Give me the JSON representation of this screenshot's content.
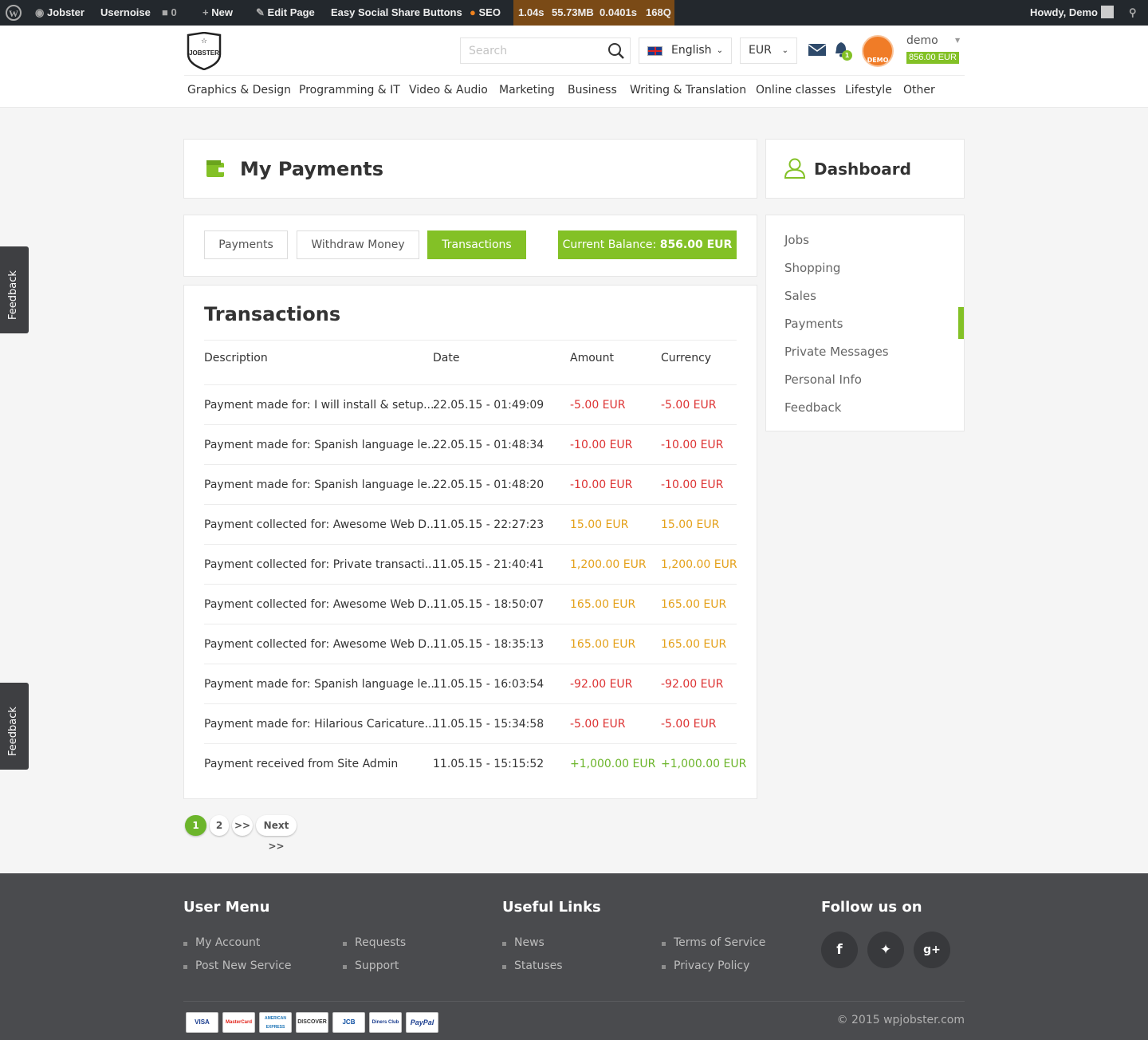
{
  "admin_bar": {
    "site": "Jobster",
    "plugin": "Usernoise",
    "comments": "0",
    "new": "New",
    "edit": "Edit Page",
    "social": "Easy Social Share Buttons",
    "seo": "SEO",
    "perf": {
      "time": "1.04s",
      "memory": "55.73MB",
      "db_time": "0.0401s",
      "queries": "168Q"
    },
    "howdy": "Howdy, Demo"
  },
  "header": {
    "logo": "JOBSTER",
    "search_placeholder": "Search",
    "language": "English",
    "currency": "EUR",
    "notifications": "1",
    "user": {
      "name": "demo",
      "balance": "856.00 EUR",
      "avatar_label": "DEMO"
    }
  },
  "nav": [
    "Graphics & Design",
    "Programming & IT",
    "Video & Audio",
    "Marketing",
    "Business",
    "Writing & Translation",
    "Online classes",
    "Lifestyle",
    "Other"
  ],
  "page": {
    "title": "My Payments",
    "tabs": [
      "Payments",
      "Withdraw Money",
      "Transactions"
    ],
    "balance_label": "Current Balance:",
    "balance_value": "856.00 EUR"
  },
  "transactions": {
    "title": "Transactions",
    "columns": [
      "Description",
      "Date",
      "Amount",
      "Currency"
    ],
    "rows": [
      {
        "desc": "Payment made for: I will install & setup...",
        "date": "22.05.15 - 01:49:09",
        "amount": "-5.00 EUR",
        "currency": "-5.00 EUR",
        "type": "neg"
      },
      {
        "desc": "Payment made for: Spanish language le...",
        "date": "22.05.15 - 01:48:34",
        "amount": "-10.00 EUR",
        "currency": "-10.00 EUR",
        "type": "neg"
      },
      {
        "desc": "Payment made for: Spanish language le...",
        "date": "22.05.15 - 01:48:20",
        "amount": "-10.00 EUR",
        "currency": "-10.00 EUR",
        "type": "neg"
      },
      {
        "desc": "Payment collected for: Awesome Web D...",
        "date": "11.05.15 - 22:27:23",
        "amount": "15.00 EUR",
        "currency": "15.00 EUR",
        "type": "col"
      },
      {
        "desc": "Payment collected for: Private transacti...",
        "date": "11.05.15 - 21:40:41",
        "amount": "1,200.00 EUR",
        "currency": "1,200.00 EUR",
        "type": "col"
      },
      {
        "desc": "Payment collected for: Awesome Web D...",
        "date": "11.05.15 - 18:50:07",
        "amount": "165.00 EUR",
        "currency": "165.00 EUR",
        "type": "col"
      },
      {
        "desc": "Payment collected for: Awesome Web D...",
        "date": "11.05.15 - 18:35:13",
        "amount": "165.00 EUR",
        "currency": "165.00 EUR",
        "type": "col"
      },
      {
        "desc": "Payment made for: Spanish language le...",
        "date": "11.05.15 - 16:03:54",
        "amount": "-92.00 EUR",
        "currency": "-92.00 EUR",
        "type": "neg"
      },
      {
        "desc": "Payment made for: Hilarious Caricature...",
        "date": "11.05.15 - 15:34:58",
        "amount": "-5.00 EUR",
        "currency": "-5.00 EUR",
        "type": "neg"
      },
      {
        "desc": "Payment received from Site Admin",
        "date": "11.05.15 - 15:15:52",
        "amount": "+1,000.00 EUR",
        "currency": "+1,000.00 EUR",
        "type": "pos"
      }
    ]
  },
  "pagination": {
    "pages": [
      "1",
      "2"
    ],
    "more": ">>",
    "next": "Next >>"
  },
  "sidebar": {
    "title": "Dashboard",
    "items": [
      "Jobs",
      "Shopping",
      "Sales",
      "Payments",
      "Private Messages",
      "Personal Info",
      "Feedback"
    ],
    "active": "Payments"
  },
  "feedback_tab": "Feedback",
  "footer": {
    "user_menu": {
      "title": "User Menu",
      "col1": [
        "My Account",
        "Post New Service"
      ],
      "col2": [
        "Requests",
        "Support"
      ]
    },
    "useful_links": {
      "title": "Useful Links",
      "col1": [
        "News",
        "Statuses"
      ],
      "col2": [
        "Terms of Service",
        "Privacy Policy"
      ]
    },
    "follow": {
      "title": "Follow us on",
      "icons": [
        "facebook-icon",
        "twitter-icon",
        "google-plus-icon"
      ]
    },
    "cards": [
      "VISA",
      "MasterCard",
      "AMERICAN EXPRESS",
      "DISCOVER",
      "JCB",
      "Diners Club",
      "PayPal"
    ],
    "copyright": "© 2015 wpjobster.com"
  },
  "colors": {
    "accent": "#83c126",
    "negative": "#dd3333",
    "collected": "#e4a11b",
    "positive": "#6cb52b",
    "adminbar": "#23282d",
    "footer": "#4a4b4e"
  }
}
